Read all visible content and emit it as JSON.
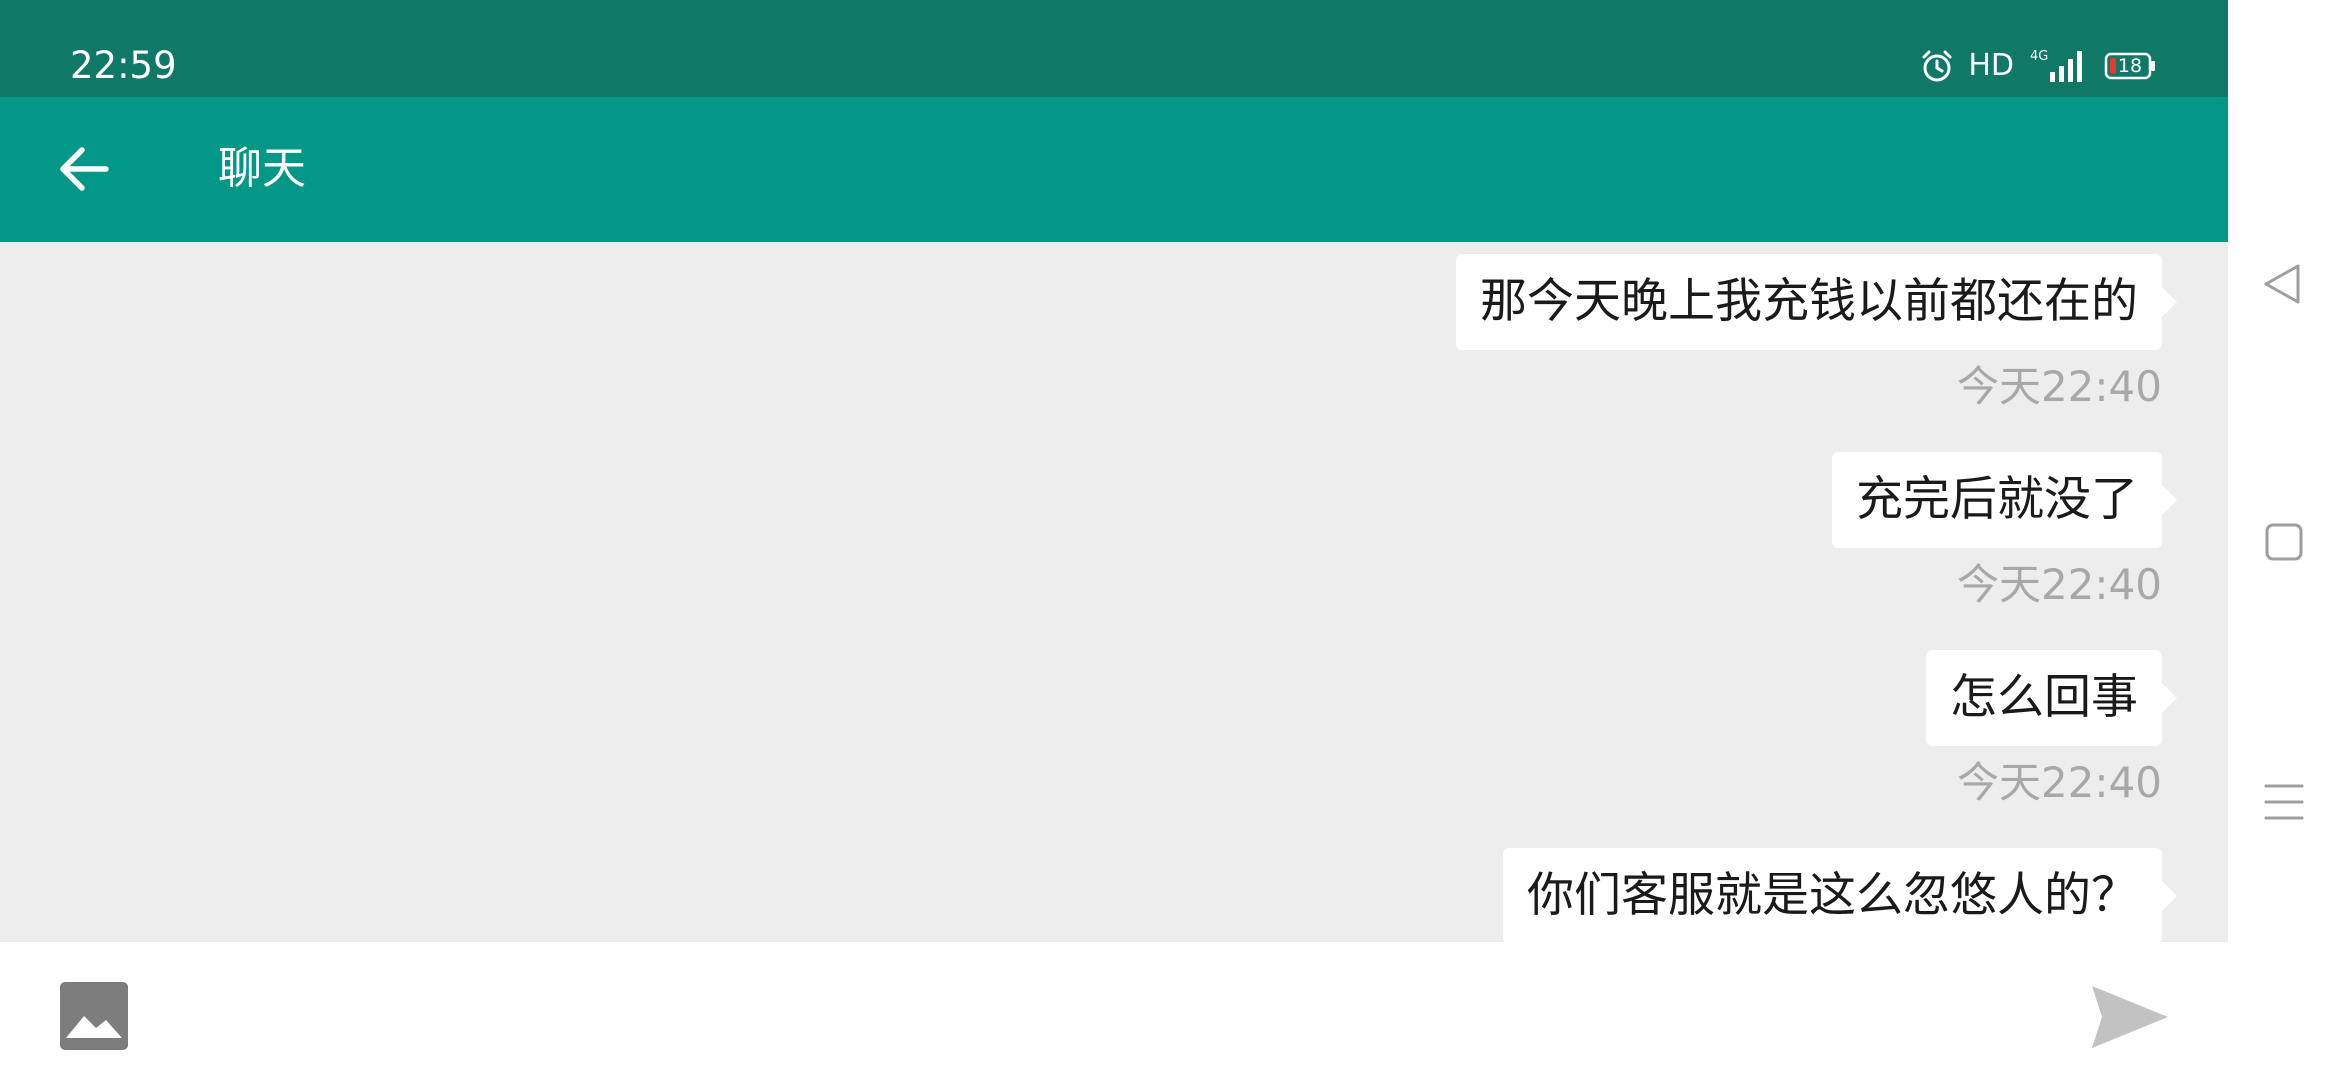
{
  "status_bar": {
    "time": "22:59",
    "icons": [
      "alarm-icon",
      "hd-icon",
      "signal-4g-icon",
      "battery-icon"
    ],
    "hd_label": "HD",
    "network_label": "4G",
    "battery_level": "18",
    "background": "#0f7867"
  },
  "app_bar": {
    "title": "聊天",
    "back_icon": "arrow-left-icon",
    "background": "#029787"
  },
  "messages": [
    {
      "text": "那今天晚上我充钱以前都还在的",
      "time": "今天22:40",
      "side": "right"
    },
    {
      "text": "充完后就没了",
      "time": "今天22:40",
      "side": "right"
    },
    {
      "text": "怎么回事",
      "time": "今天22:40",
      "side": "right"
    },
    {
      "text": "你们客服就是这么忽悠人的？",
      "side": "right"
    }
  ],
  "input_bar": {
    "image_icon": "image-icon",
    "send_icon": "send-icon"
  },
  "nav_bar": {
    "icons": [
      "back-triangle-icon",
      "home-square-icon",
      "menu-lines-icon"
    ]
  },
  "colors": {
    "chat_background": "#ededed",
    "bubble": "#ffffff",
    "timestamp": "#a8a8a8"
  }
}
